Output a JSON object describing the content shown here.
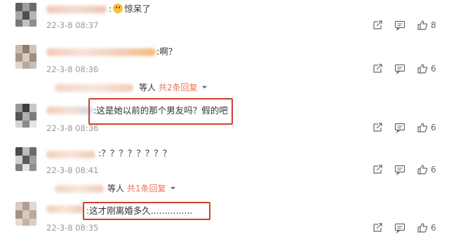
{
  "comments": [
    {
      "text": ":惊呆了",
      "time": "22-3-8 08:37",
      "likes": "8",
      "has_emoji": true
    },
    {
      "text": ":啊？",
      "time": "22-3-8 08:36",
      "likes": "6"
    },
    {
      "text": ":这是她以前的那个男友吗？假的吧",
      "time": "22-3-8 08:36",
      "likes": "6"
    },
    {
      "text": ":？？？？？？？？",
      "time": "22-3-8 08:41",
      "likes": "6"
    },
    {
      "text": ":这才刚离婚多久...............",
      "time": "22-3-8 08:35",
      "likes": "6"
    }
  ],
  "replies": [
    {
      "prefix": "等人",
      "link": "共2条回复"
    },
    {
      "prefix": "等人",
      "link": "共1条回复"
    }
  ],
  "colors": {
    "accent": "#eb7350",
    "highlight": "#d0402a",
    "timestamp": "#999999"
  },
  "icons": [
    "share-icon",
    "comment-icon",
    "like-icon",
    "chevron-down-icon"
  ]
}
